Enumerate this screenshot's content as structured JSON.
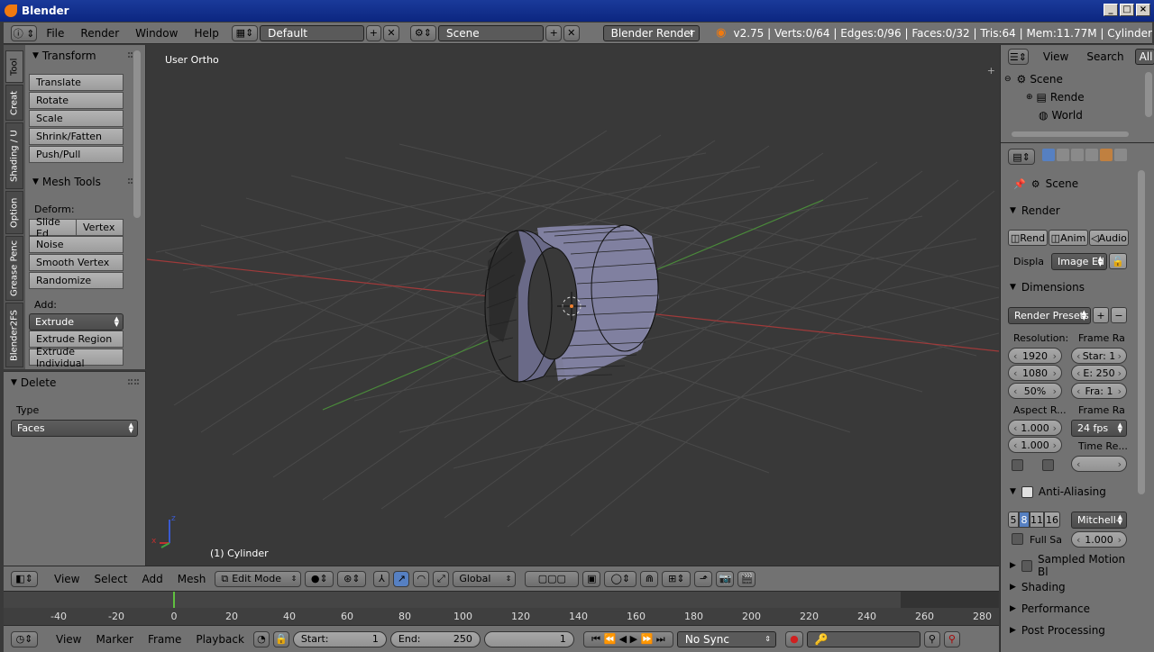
{
  "window": {
    "title": "Blender"
  },
  "info_header": {
    "menus": [
      "File",
      "Render",
      "Window",
      "Help"
    ],
    "screen_layout": "Default",
    "scene": "Scene",
    "render_engine": "Blender Render",
    "stats": "v2.75 | Verts:0/64 | Edges:0/96 | Faces:0/32 | Tris:64 | Mem:11.77M | Cylinder"
  },
  "tool_tabs": [
    "Tool",
    "Creat",
    "Shading / U",
    "Option",
    "Grease Penc",
    "Blender2FS"
  ],
  "tool_shelf": {
    "transform": {
      "title": "Transform",
      "buttons": [
        "Translate",
        "Rotate",
        "Scale",
        "Shrink/Fatten",
        "Push/Pull"
      ]
    },
    "mesh_tools": {
      "title": "Mesh Tools",
      "deform_label": "Deform:",
      "deform_buttons": [
        "Slide Ed",
        "Vertex",
        "Noise",
        "Smooth Vertex",
        "Randomize"
      ],
      "add_label": "Add:",
      "extrude_select": "Extrude",
      "add_buttons": [
        "Extrude Region",
        "Extrude Individual"
      ]
    }
  },
  "operator_panel": {
    "title": "Delete",
    "type_label": "Type",
    "type_value": "Faces"
  },
  "viewport": {
    "view_name": "User Ortho",
    "object_label": "(1) Cylinder"
  },
  "view3d_header": {
    "menus": [
      "View",
      "Select",
      "Add",
      "Mesh"
    ],
    "mode": "Edit Mode",
    "orientation": "Global"
  },
  "timeline": {
    "ticks": [
      -40,
      -20,
      0,
      20,
      40,
      60,
      80,
      100,
      120,
      140,
      160,
      180,
      200,
      220,
      240,
      260,
      280
    ],
    "current_frame": 1,
    "menus": [
      "View",
      "Marker",
      "Frame",
      "Playback"
    ],
    "start_label": "Start:",
    "start_value": "1",
    "end_label": "End:",
    "end_value": "250",
    "frame_value": "1",
    "sync": "No Sync"
  },
  "outliner": {
    "menus": [
      "View",
      "Search"
    ],
    "filter": "All",
    "rows": [
      "Scene",
      "Rende",
      "World"
    ]
  },
  "properties": {
    "context": "Scene",
    "render": {
      "title": "Render",
      "buttons": [
        "Rend",
        "Anim",
        "Audio"
      ],
      "display_label": "Displa",
      "display_value": "Image Ed"
    },
    "dimensions": {
      "title": "Dimensions",
      "presets": "Render Presets",
      "resolution_label": "Resolution:",
      "res_x": "1920",
      "res_y": "1080",
      "res_pct": "50%",
      "frame_range_label": "Frame Ra",
      "start": "Star: 1",
      "end": "E: 250",
      "step": "Fra: 1",
      "aspect_label": "Aspect R...",
      "aspect_x": "1.000",
      "aspect_y": "1.000",
      "frame_rate_label": "Frame Ra",
      "fps": "24 fps",
      "time_remap_label": "Time Re..."
    },
    "anti_aliasing": {
      "title": "Anti-Aliasing",
      "samples": [
        "5",
        "8",
        "11",
        "16"
      ],
      "filter": "Mitchell-",
      "full_sample": "Full Sa",
      "size": "1.000"
    },
    "collapsed_panels": [
      "Sampled Motion Bl",
      "Shading",
      "Performance",
      "Post Processing"
    ]
  },
  "colors": {
    "accent": "#5680c2",
    "x_axis": "#a03a3a",
    "y_axis": "#4a8a3a",
    "mesh": "#8a8aa8"
  }
}
